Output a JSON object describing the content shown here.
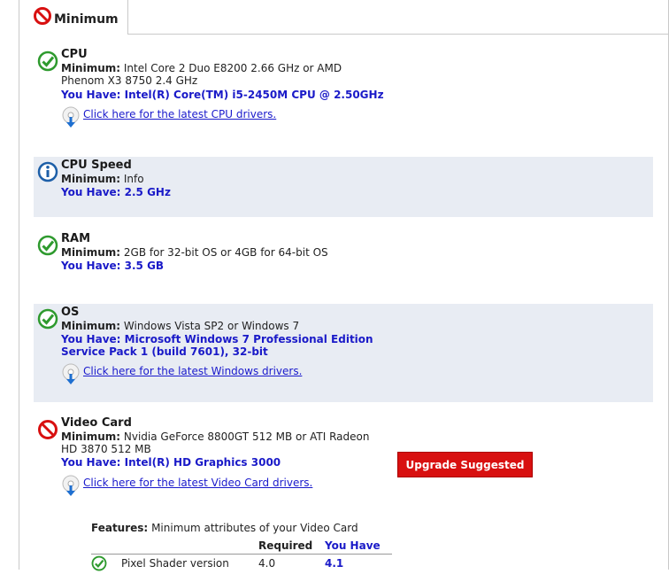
{
  "tab": {
    "label": "Minimum"
  },
  "requirements": [
    {
      "title": "CPU",
      "status": "pass",
      "minimum_label": "Minimum:",
      "minimum_line1": "Intel Core 2 Duo E8200 2.66 GHz or AMD",
      "minimum_line2": "Phenom X3 8750 2.4 GHz",
      "you_have_label": "You Have:",
      "you_have": "Intel(R) Core(TM) i5-2450M CPU @ 2.50GHz",
      "driver_link": "Click here for the latest CPU drivers."
    },
    {
      "title": "CPU Speed",
      "status": "info",
      "minimum_label": "Minimum:",
      "minimum_line1": "Info",
      "you_have_label": "You Have:",
      "you_have": "2.5 GHz"
    },
    {
      "title": "RAM",
      "status": "pass",
      "minimum_label": "Minimum:",
      "minimum_line1": "2GB for 32-bit OS or 4GB for 64-bit OS",
      "you_have_label": "You Have:",
      "you_have": "3.5 GB"
    },
    {
      "title": "OS",
      "status": "pass",
      "minimum_label": "Minimum:",
      "minimum_line1": "Windows Vista SP2 or Windows 7",
      "you_have_label": "You Have:",
      "you_have": "Microsoft Windows 7 Professional Edition",
      "you_have_line2": "Service Pack 1 (build 7601), 32-bit",
      "driver_link": "Click here for the latest Windows drivers."
    },
    {
      "title": "Video Card",
      "status": "fail",
      "minimum_label": "Minimum:",
      "minimum_line1": "Nvidia GeForce 8800GT 512 MB or ATI Radeon",
      "minimum_line2": "HD 3870 512 MB",
      "you_have_label": "You Have:",
      "you_have": "Intel(R) HD Graphics 3000",
      "driver_link": "Click here for the latest Video Card drivers.",
      "upgrade_label": "Upgrade Suggested"
    }
  ],
  "features": {
    "title_bold": "Features:",
    "title_rest": "Minimum attributes of your Video Card",
    "col_required": "Required",
    "col_you_have": "You Have",
    "rows": [
      {
        "name": "Pixel Shader version",
        "required": "4.0",
        "you_have": "4.1",
        "status": "pass"
      }
    ]
  },
  "colors": {
    "pass_green": "#2e9a2e",
    "fail_red": "#d81010",
    "info_blue": "#1d5fa8",
    "you_have_blue": "#1a1ac8",
    "shaded_row": "#e8ecf3"
  }
}
